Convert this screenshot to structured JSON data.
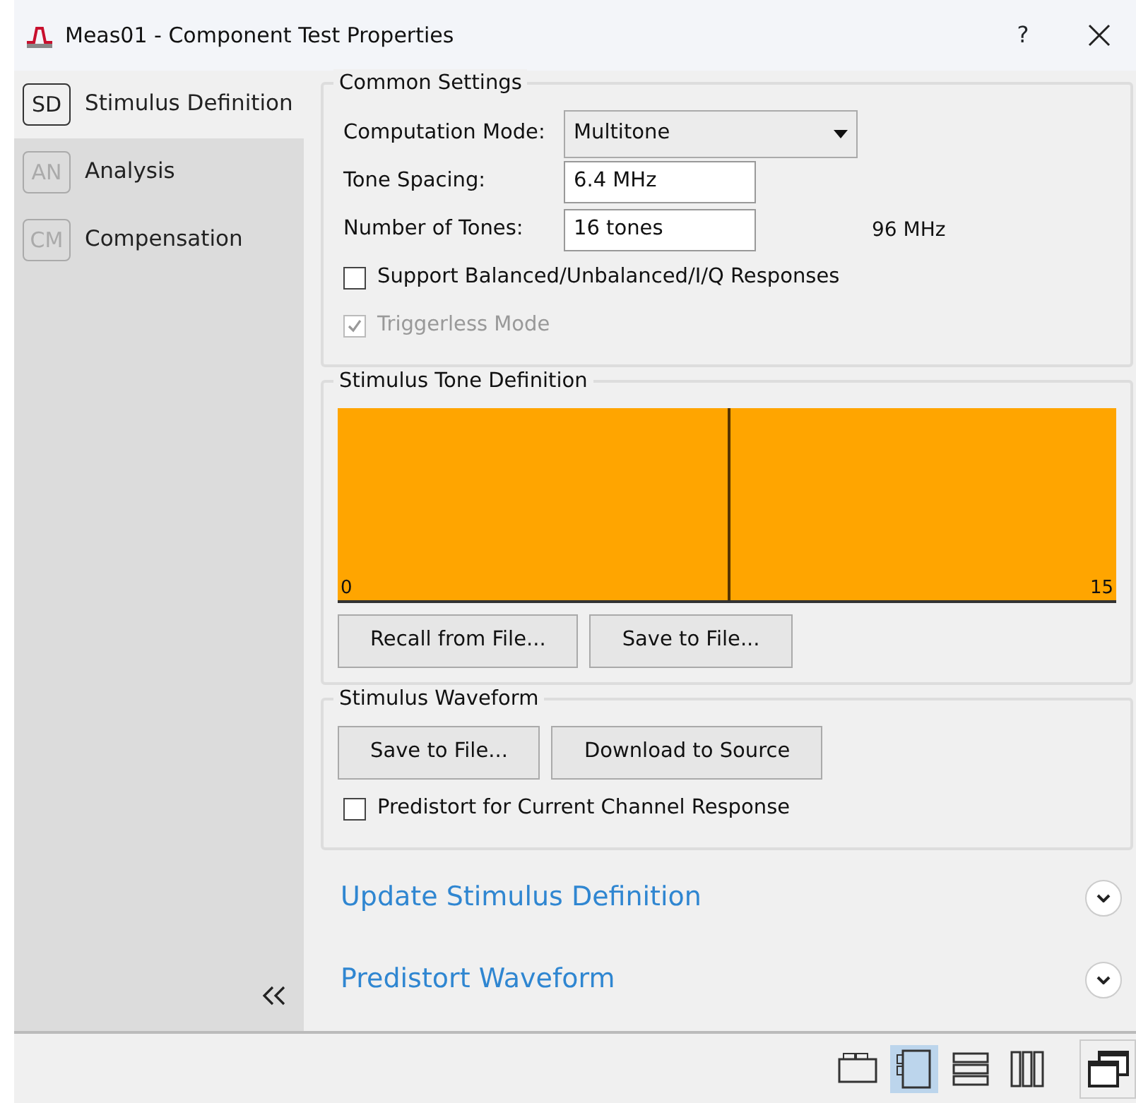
{
  "window": {
    "title": "Meas01 - Component Test Properties",
    "help": "?"
  },
  "sidebar": {
    "items": [
      {
        "abbr": "SD",
        "label": "Stimulus Definition",
        "selected": true
      },
      {
        "abbr": "AN",
        "label": "Analysis",
        "selected": false
      },
      {
        "abbr": "CM",
        "label": "Compensation",
        "selected": false
      }
    ]
  },
  "common_settings": {
    "title": "Common Settings",
    "computation_mode": {
      "label": "Computation Mode:",
      "value": "Multitone"
    },
    "tone_spacing": {
      "label": "Tone Spacing:",
      "value": "6.4 MHz"
    },
    "number_of_tones": {
      "label": "Number of Tones:",
      "value": "16 tones",
      "readout": "96 MHz"
    },
    "checkboxes": [
      {
        "label": "Support Balanced/Unbalanced/I/Q Responses",
        "checked": false,
        "disabled": false
      },
      {
        "label": "Triggerless Mode",
        "checked": true,
        "disabled": true
      }
    ]
  },
  "stimulus_tone_definition": {
    "title": "Stimulus Tone Definition",
    "plot": {
      "start_label": "0",
      "end_label": "15"
    },
    "buttons": [
      "Recall from File...",
      "Save to File..."
    ]
  },
  "stimulus_waveform": {
    "title": "Stimulus Waveform",
    "buttons": [
      "Save to File...",
      "Download to Source"
    ],
    "checkbox": {
      "label": "Predistort for Current Channel Response",
      "checked": false
    }
  },
  "sections": [
    {
      "label": "Update Stimulus Definition",
      "expanded": false
    },
    {
      "label": "Predistort Waveform",
      "expanded": false
    }
  ],
  "view_modes": [
    {
      "kind": "tabs",
      "selected": false
    },
    {
      "kind": "panel",
      "selected": true
    },
    {
      "kind": "rows",
      "selected": false
    },
    {
      "kind": "columns",
      "selected": false
    }
  ]
}
